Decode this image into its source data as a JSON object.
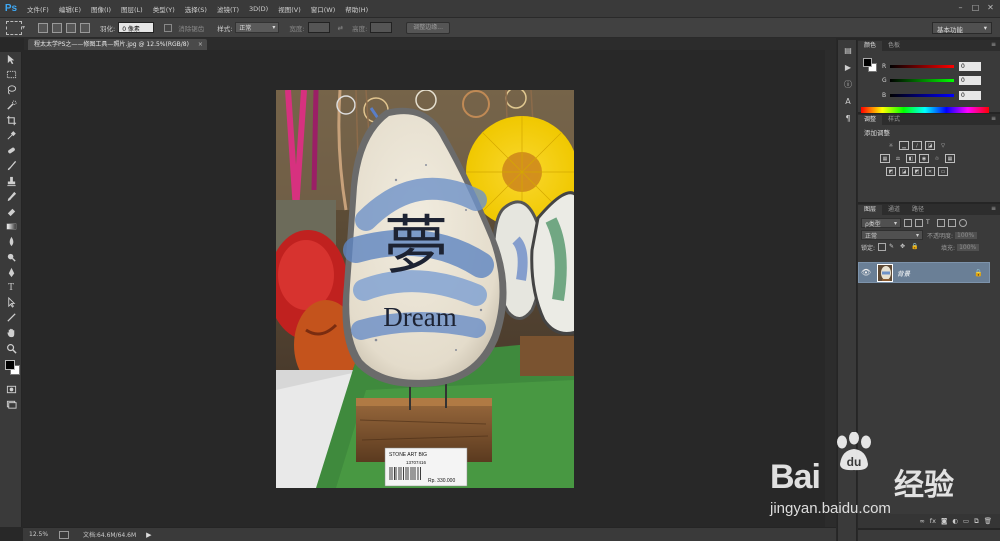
{
  "app": {
    "logo": "Ps",
    "menu": [
      "文件(F)",
      "编辑(E)",
      "图像(I)",
      "图层(L)",
      "类型(Y)",
      "选择(S)",
      "滤镜(T)",
      "3D(D)",
      "视图(V)",
      "窗口(W)",
      "帮助(H)"
    ],
    "window_buttons": [
      "–",
      "□",
      "✕"
    ]
  },
  "options_bar": {
    "feather_label": "羽化:",
    "feather_value": "0 像素",
    "antialias_label": "消除锯齿",
    "style_label": "样式:",
    "style_value": "正常",
    "width_label": "宽度:",
    "height_label": "高度:",
    "refine_edge_button": "调整边缘...",
    "workspace_value": "基本功能"
  },
  "document": {
    "tab_label": "程太太学PS之——修图工具—照片.jpg @ 12.5%(RGB/8)",
    "tab_close": "×"
  },
  "status": {
    "zoom": "12.5%",
    "doc_size": "文档:64.6M/64.6M",
    "arrow": "▶"
  },
  "photo": {
    "stone_character": "夢",
    "stone_word": "Dream",
    "price_tag_title": "STONE ART BIG",
    "price_tag_code": "13707416",
    "price_tag_price": "Rp. 330.000"
  },
  "color_panel": {
    "tabs": [
      "颜色",
      "色板"
    ],
    "channels": [
      {
        "letter": "R",
        "value": "0",
        "gradient": "linear-gradient(90deg,#000,#f00)"
      },
      {
        "letter": "G",
        "value": "0",
        "gradient": "linear-gradient(90deg,#000,#0f0)"
      },
      {
        "letter": "B",
        "value": "0",
        "gradient": "linear-gradient(90deg,#000,#00f)"
      }
    ]
  },
  "adjustments_panel": {
    "tabs": [
      "调整",
      "样式"
    ],
    "title": "添加调整"
  },
  "layers_panel": {
    "tabs": [
      "图层",
      "通道",
      "路径"
    ],
    "kind_filter": "ρ类型",
    "blend_mode": "正常",
    "opacity_label": "不透明度:",
    "opacity_value": "100%",
    "lock_label": "锁定:",
    "fill_label": "填充:",
    "fill_value": "100%",
    "layer_name": "背景",
    "bottom_icons": [
      "∞",
      "fx",
      "◙",
      "◐",
      "▭",
      "⧉",
      "🗑"
    ]
  },
  "watermark": {
    "brand": "Bai",
    "brand2": "du",
    "product": "经验",
    "url": "jingyan.baidu.com"
  },
  "colors": {
    "accent": "#3fa9f5",
    "panel_bg": "#3a3a3a",
    "canvas_bg": "#282828",
    "layer_selected": "#6a7f96"
  }
}
